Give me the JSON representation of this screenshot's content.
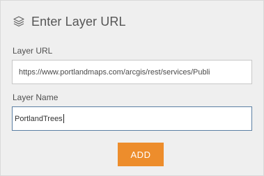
{
  "header": {
    "icon": "layers-icon",
    "title": "Enter Layer URL"
  },
  "form": {
    "url_label": "Layer URL",
    "url_value": "https://www.portlandmaps.com/arcgis/rest/services/Publi",
    "name_label": "Layer Name",
    "name_value": "PortlandTrees",
    "add_label": "ADD"
  },
  "colors": {
    "panel_background": "#efefef",
    "accent_button": "#ed8d2c",
    "focused_input_border": "#5b7fa3"
  }
}
